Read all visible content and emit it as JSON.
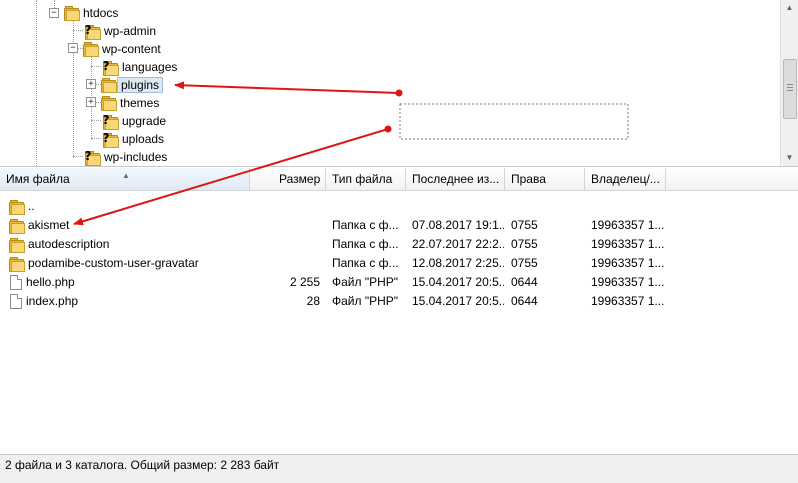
{
  "tree": {
    "items": [
      {
        "label": "htdocs",
        "icon": "folder-icon",
        "expander": "minus"
      },
      {
        "label": "wp-admin",
        "icon": "unknown-folder-icon"
      },
      {
        "label": "wp-content",
        "icon": "folder-icon",
        "expander": "minus"
      },
      {
        "label": "languages",
        "icon": "unknown-folder-icon"
      },
      {
        "label": "plugins",
        "icon": "folder-icon",
        "expander": "plus",
        "selected": true
      },
      {
        "label": "themes",
        "icon": "folder-icon",
        "expander": "plus"
      },
      {
        "label": "upgrade",
        "icon": "unknown-folder-icon"
      },
      {
        "label": "uploads",
        "icon": "unknown-folder-icon"
      },
      {
        "label": "wp-includes",
        "icon": "unknown-folder-icon"
      }
    ]
  },
  "list": {
    "columns": {
      "name": "Имя файла",
      "size": "Размер",
      "type": "Тип файла",
      "modified": "Последнее из...",
      "perms": "Права",
      "owner": "Владелец/..."
    },
    "sorted_column": "name",
    "rows": [
      {
        "name": "..",
        "size": "",
        "type": "",
        "modified": "",
        "perms": "",
        "owner": "",
        "icon": "folder-icon"
      },
      {
        "name": "akismet",
        "size": "",
        "type": "Папка с ф...",
        "modified": "07.08.2017 19:1...",
        "perms": "0755",
        "owner": "19963357 1...",
        "icon": "folder-icon"
      },
      {
        "name": "autodescription",
        "size": "",
        "type": "Папка с ф...",
        "modified": "22.07.2017 22:2...",
        "perms": "0755",
        "owner": "19963357 1...",
        "icon": "folder-icon"
      },
      {
        "name": "podamibe-custom-user-gravatar",
        "size": "",
        "type": "Папка с ф...",
        "modified": "12.08.2017 2:25...",
        "perms": "0755",
        "owner": "19963357 1...",
        "icon": "folder-icon"
      },
      {
        "name": "hello.php",
        "size": "2 255",
        "type": "Файл \"PHP\"",
        "modified": "15.04.2017 20:5...",
        "perms": "0644",
        "owner": "19963357 1...",
        "icon": "file-icon"
      },
      {
        "name": "index.php",
        "size": "28",
        "type": "Файл \"PHP\"",
        "modified": "15.04.2017 20:5...",
        "perms": "0644",
        "owner": "19963357 1...",
        "icon": "file-icon"
      }
    ]
  },
  "status": {
    "text": "2 файла и 3 каталога. Общий размер: 2 283 байт"
  },
  "colors": {
    "arrow": "#e01414",
    "folder": "#e8b93a",
    "selection": "#dde8f5"
  }
}
